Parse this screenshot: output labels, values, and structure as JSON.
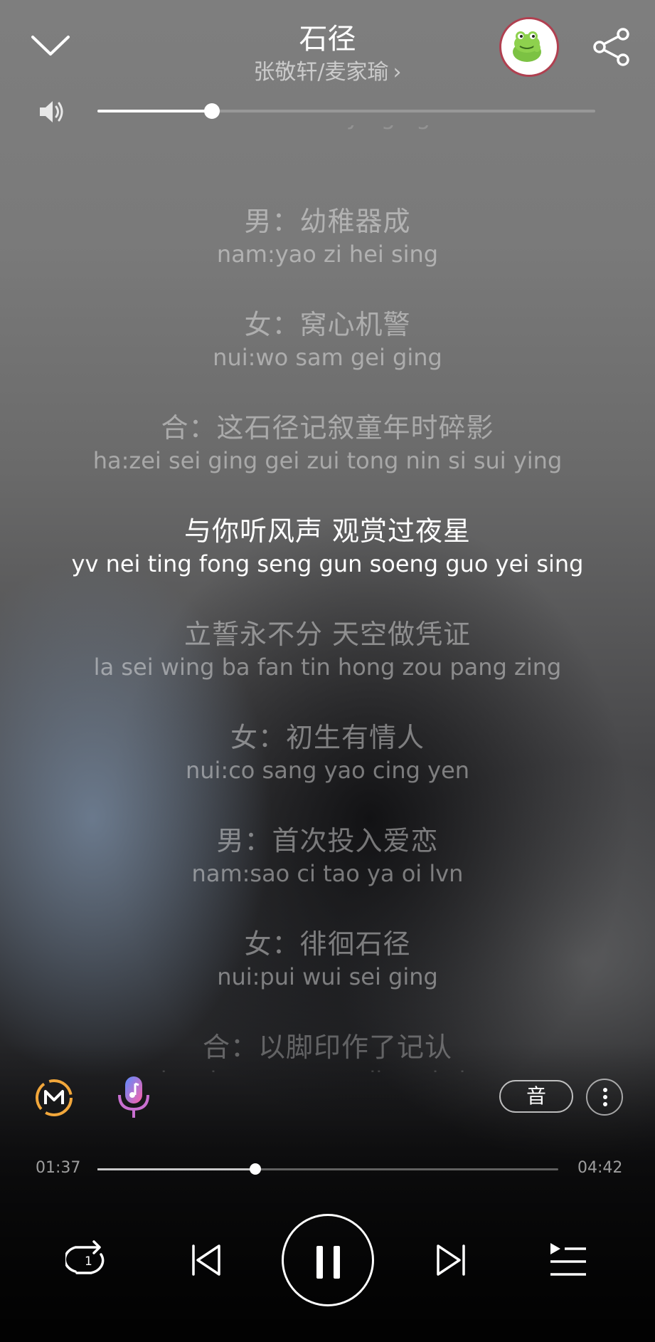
{
  "header": {
    "title": "石径",
    "artist": "张敬轩/麦家瑜",
    "artist_chevron": "›"
  },
  "volume": {
    "level": 0.23
  },
  "lyrics": [
    {
      "cn": "",
      "py": "nui:do mo ya ging",
      "state": "fade-top"
    },
    {
      "cn": "男：幼稚器成",
      "py": "nam:yao zi hei sing",
      "state": "normal"
    },
    {
      "cn": "女：窝心机警",
      "py": "nui:wo sam gei ging",
      "state": "normal"
    },
    {
      "cn": "合：这石径记叙童年时碎影",
      "py": "ha:zei sei ging gei zui tong nin si sui ying",
      "state": "normal"
    },
    {
      "cn": "与你听风声 观赏过夜星",
      "py": "yv nei ting fong seng gun soeng guo yei sing",
      "state": "current"
    },
    {
      "cn": "立誓永不分 天空做凭证",
      "py": "la sei wing ba fan tin hong zou pang zing",
      "state": "normal"
    },
    {
      "cn": "女：初生有情人",
      "py": "nui:co sang yao cing yen",
      "state": "normal"
    },
    {
      "cn": "男：首次投入爱恋",
      "py": "nam:sao ci tao ya oi lvn",
      "state": "normal"
    },
    {
      "cn": "女：徘徊石径",
      "py": "nui:pui wui sei ging",
      "state": "normal"
    },
    {
      "cn": "合：以脚印作了记认",
      "py": "ha:yi goe yan zao liu gei ying",
      "state": "fade-bottom"
    }
  ],
  "tools": {
    "sound_effect_label": "音"
  },
  "progress": {
    "elapsed": "01:37",
    "total": "04:42",
    "fraction": 0.343
  },
  "controls": {
    "repeat_count": "1"
  },
  "colors": {
    "avatar_ring": "#b04050",
    "mic_gradient_start": "#5b8cff",
    "mic_gradient_end": "#ff5fa8",
    "m_logo_ring": "#f2a73b"
  }
}
